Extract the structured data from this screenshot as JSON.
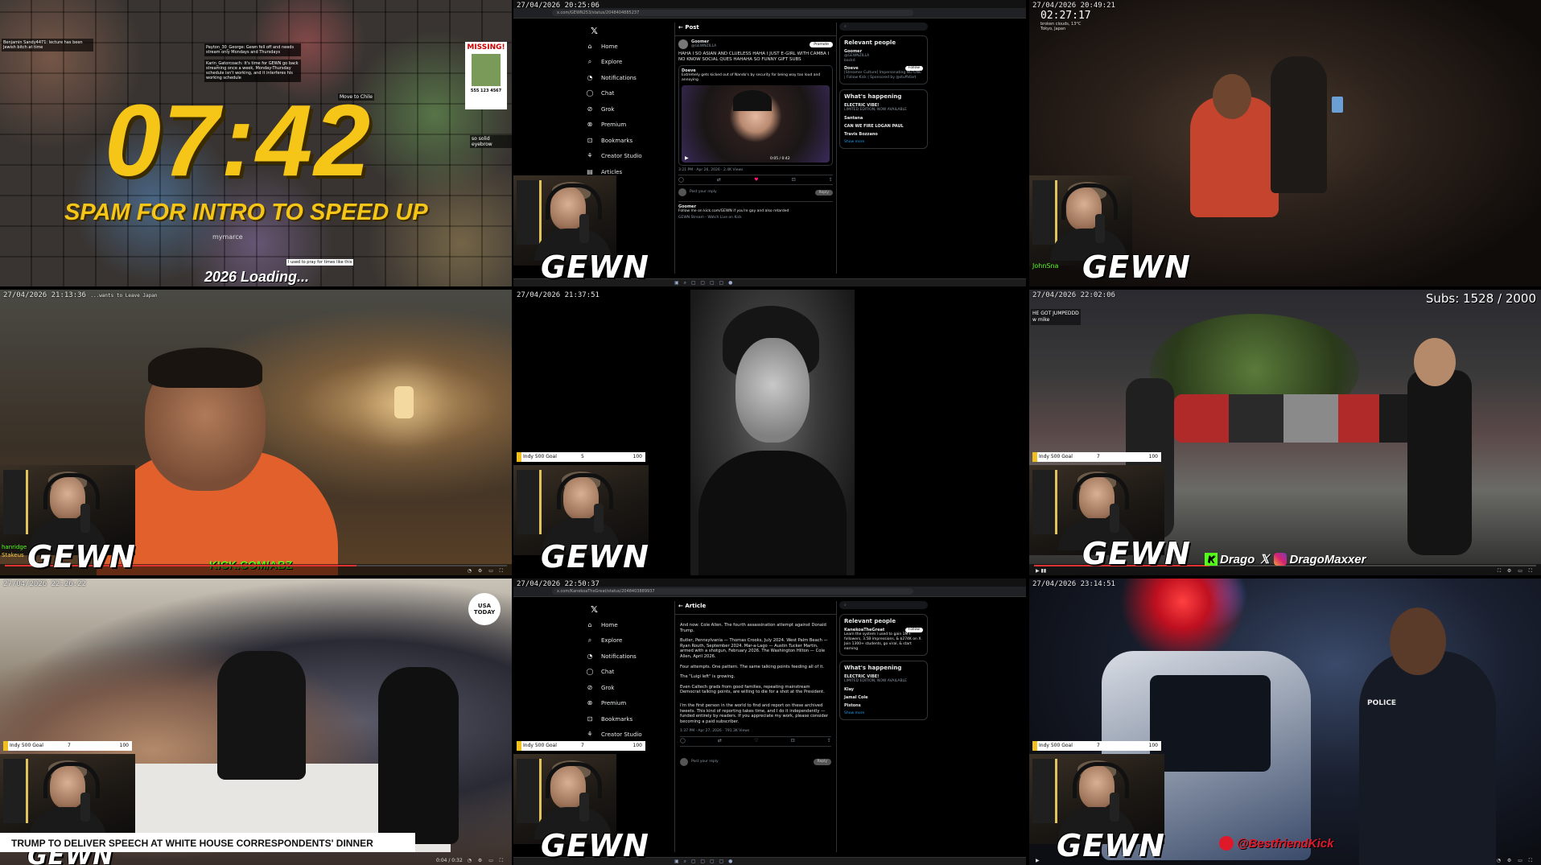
{
  "tiles": {
    "t1": {
      "timer": "07:42",
      "spam": "SPAM FOR INTRO TO SPEED UP",
      "loading": "2026 Loading...",
      "chat1": "Benjamin Sandy4471: lecture has been Jewish bitch at time",
      "chat2": "Payton_30_George: Gewn fell off and needs stream only Mondays and Thursdays",
      "chat3": "Karin_Gatorcoach: It's time for GEWN go back streaming once a week, Monday-Thursday schedule isn't working, and it interferes his working schedule",
      "missing": "MISSING!",
      "missing_phone": "555 123 4567",
      "tag_chile": "Move to Chile",
      "tag_eyebrow": "so solid eyebrow",
      "tag_mymarce": "mymarce",
      "tag_used": "I used to pray for times like this"
    },
    "t2": {
      "timestamp": "27/04/2026 20:25:06",
      "url": "x.com/GEWN253/status/2048404885237",
      "nav": [
        "Home",
        "Explore",
        "Notifications",
        "Chat",
        "Grok",
        "Premium",
        "Bookmarks",
        "Creator Studio",
        "Articles"
      ],
      "post_header": "Post",
      "author": "Goomer",
      "handle": "@GEWNZILLA",
      "post_text": "HAHA I SO ASIAN AND CLUELESS HAHA I JUST E-GIRL WITH CAMBA I NO KNOW SOCIAL QUES HAHAHA SO FUNNY GIFT SUBS",
      "quote_author": "Doeve",
      "quote_text": "Extremely gets kicked out of Nando's by security for being way too loud and annoying",
      "video_time": "0:05 / 0:42",
      "post_meta": "3:21 PM · Apr 26, 2026 · 2.4K Views",
      "reply_placeholder": "Post your reply",
      "reply_button": "Reply",
      "reply2_author": "Goomer",
      "reply2_text": "Follow me on kick.com/GEWN if you're gay and also retarded",
      "reply2_link": "GEWN Stream - Watch Live on Kick",
      "relevant_people": "Relevant people",
      "rp1_name": "Goomer",
      "rp1_handle": "@GEWNZILLA",
      "rp1_bio": "backd",
      "rp2_name": "Doeve",
      "rp2_bio": "[Streamer Culture] Impersonating NO ONE | Follow Kick | Sponsored by @stuffstart",
      "follow_label": "Follow",
      "whats_happening": "What's happening",
      "trend1": "ELECTRIC VIBE!",
      "trend1_sub": "LIMITED EDITION, NOW AVAILABLE",
      "trend2": "Santana",
      "trend3": "CAN WE FIRE LOGAN PAUL",
      "trend4": "Travis Bozzano",
      "show_more": "Show more",
      "gewn": "GEWN"
    },
    "t3": {
      "timestamp": "27/04/2026 20:49:21",
      "big_time": "02:27:17",
      "weather": "broken clouds, 13°C",
      "location": "Tokyo, Japan",
      "chat_name": "JohnSna",
      "gewn": "GEWN"
    },
    "t4": {
      "timestamp": "27/04/2026 21:13:36",
      "caption": "...wants to Leave Japan",
      "kick": "KICK.COM/ABZ",
      "chat_name": "hanridge",
      "chat_name2": "Stakeus",
      "gewn": "GEWN"
    },
    "t5": {
      "timestamp": "27/04/2026 21:37:51",
      "goal_label": "Indy 500 Goal",
      "goal_mid": "5",
      "goal_max": "100",
      "gewn": "GEWN"
    },
    "t6": {
      "timestamp": "27/04/2026 22:02:06",
      "subs": "Subs: 1528 / 2000",
      "chat_msg": "HE GOT JUMPEDDD",
      "chat_msg2": "w mike",
      "goal_label": "Indy 500 Goal",
      "goal_mid": "7",
      "goal_max": "100",
      "social_kick": "Drago",
      "social_ig": "DragoMaxxer",
      "gewn": "GEWN"
    },
    "t7": {
      "timestamp": "27/04/2026 22:26:22",
      "network": "USA TODAY",
      "headline": "TRUMP TO DELIVER SPEECH AT WHITE HOUSE CORRESPONDENTS' DINNER",
      "goal_label": "Indy 500 Goal",
      "goal_mid": "7",
      "goal_max": "100",
      "media_time": "0:04 / 0:32",
      "gewn": "GEWN"
    },
    "t8": {
      "timestamp": "27/04/2026 22:50:37",
      "url": "x.com/KanekoaTheGreat/status/2048403889937",
      "nav": [
        "Home",
        "Explore",
        "Notifications",
        "Chat",
        "Grok",
        "Premium",
        "Bookmarks",
        "Creator Studio"
      ],
      "article_header": "Article",
      "para1": "And now: Cole Allen. The fourth assassination attempt against Donald Trump.",
      "para2": "Butler, Pennsylvania — Thomas Crooks, July 2024. West Palm Beach — Ryan Routh, September 2024. Mar-a-Lago — Austin Tucker Martin, armed with a shotgun, February 2026. The Washington Hilton — Cole Allen, April 2026.",
      "para3": "Four attempts. One pattern. The same talking points feeding all of it.",
      "para4": "The \"Luigi left\" is growing.",
      "para5": "Even Caltech grads from good families, repeating mainstream Democrat talking points, are willing to die for a shot at the President.",
      "para6": "I'm the first person in the world to find and report on these archived tweets. This kind of reporting takes time, and I do it independently — funded entirely by readers. If you appreciate my work, please consider becoming a paid subscriber.",
      "post_meta": "1:37 PM · Apr 27, 2026 · 791.3K Views",
      "reply_placeholder": "Post your reply",
      "reply_button": "Reply",
      "relevant_people": "Relevant people",
      "rp1_name": "KanekoaTheGreat",
      "rp1_bio": "Learn the system I used to gain 1M+ followers, 3.5B impressions, & $274K on X. Join 1300+ students, go viral, & start earning",
      "follow_label": "Follow",
      "whats_happening": "What's happening",
      "trend1": "ELECTRIC VIBE!",
      "trend1_sub": "LIMITED EDITION, NOW AVAILABLE",
      "trend2": "Klay",
      "trend3": "Jamal Cole",
      "trend4": "Pistons",
      "show_more": "Show more",
      "goal_label": "Indy 500 Goal",
      "goal_mid": "7",
      "goal_max": "100",
      "gewn": "GEWN"
    },
    "t9": {
      "timestamp": "27/04/2026 23:14:51",
      "social": "@BestfriendKick",
      "police_text": "POLICE",
      "goal_label": "Indy 500 Goal",
      "goal_mid": "7",
      "goal_max": "100",
      "gewn": "GEWN"
    }
  },
  "colors": {
    "timer_yellow": "#f5c518",
    "x_blue": "#1d9bf0",
    "kick_green": "#53fc18",
    "police_red": "#e0192a",
    "goal_yellow": "#f0c020"
  }
}
